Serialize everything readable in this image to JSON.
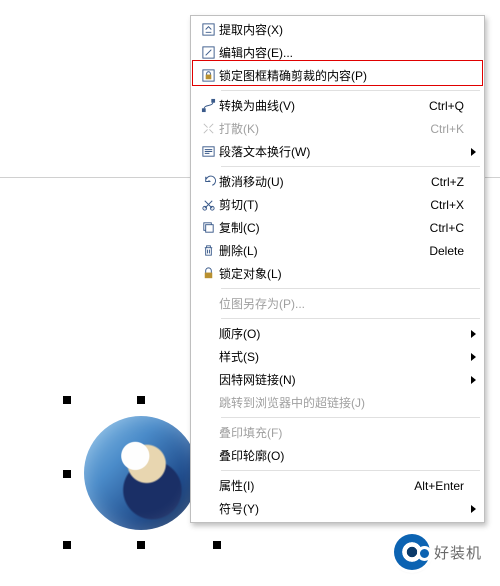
{
  "logo_text": "好装机",
  "menu": {
    "extract_content": "提取内容(X)",
    "edit_content": "编辑内容(E)...",
    "lock_crop": "锁定图框精确剪裁的内容(P)",
    "to_curve": "转换为曲线(V)",
    "to_curve_sc": "Ctrl+Q",
    "break": "打散(K)",
    "break_sc": "Ctrl+K",
    "para_wrap": "段落文本换行(W)",
    "undo_move": "撤消移动(U)",
    "undo_move_sc": "Ctrl+Z",
    "cut": "剪切(T)",
    "cut_sc": "Ctrl+X",
    "copy": "复制(C)",
    "copy_sc": "Ctrl+C",
    "delete": "删除(L)",
    "delete_sc": "Delete",
    "lock_obj": "锁定对象(L)",
    "save_bmp_as": "位图另存为(P)...",
    "order": "顺序(O)",
    "styles": "样式(S)",
    "internet_link": "因特网链接(N)",
    "jump_browser": "跳转到浏览器中的超链接(J)",
    "overprint_fill": "叠印填充(F)",
    "overprint_outline": "叠印轮廓(O)",
    "properties": "属性(I)",
    "properties_sc": "Alt+Enter",
    "symbol": "符号(Y)"
  }
}
